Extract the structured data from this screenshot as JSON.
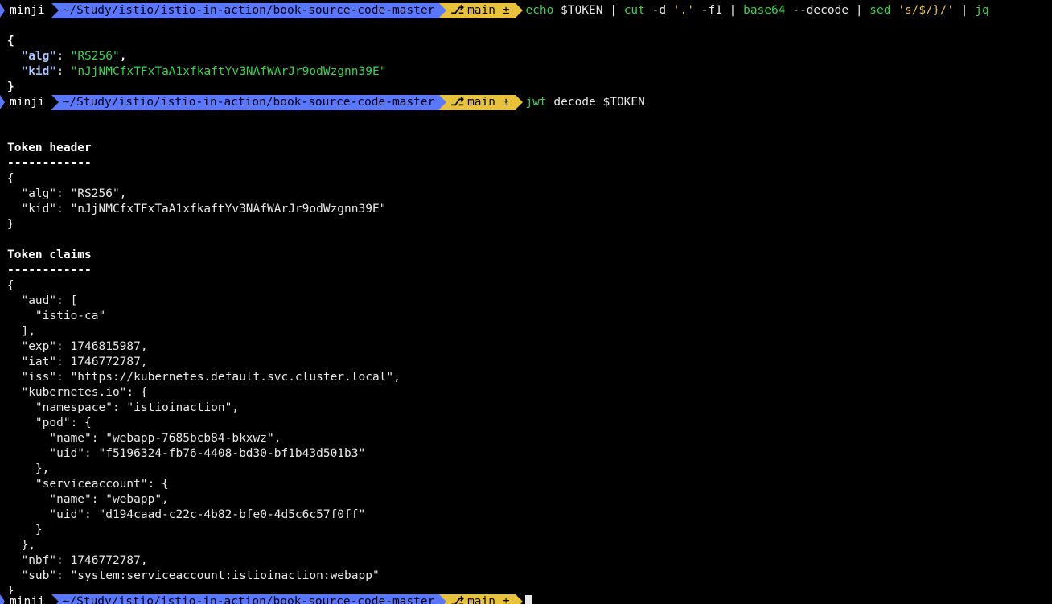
{
  "prompt": {
    "user": "minji",
    "path": "~/Study/istio/istio-in-action/book-source-code-master",
    "branch": "main ±",
    "branch_icon": "git-branch-icon"
  },
  "cmd1": {
    "echo": "echo",
    "p1": " $TOKEN | ",
    "cut": "cut",
    "p2": " -d ",
    "q1": "'.'",
    "p3": " -f1 | ",
    "base64": "base64",
    "p4": " --decode | ",
    "sed": "sed",
    "p5": " ",
    "q2": "'s/$/}/'",
    "p6": " | ",
    "jq": "jq"
  },
  "jq_output": {
    "open": "{",
    "alg_key": "\"alg\"",
    "alg_val": "\"RS256\"",
    "kid_key": "\"kid\"",
    "kid_val": "\"nJjNMCfxTFxTaA1xfkaftYv3NAfWArJr9odWzgnn39E\"",
    "close": "}"
  },
  "cmd2": {
    "jwt": "jwt",
    "rest": " decode $TOKEN"
  },
  "decode_output": {
    "header_title": "Token header",
    "header_rule": "------------",
    "header_lines": [
      "{",
      "  \"alg\": \"RS256\",",
      "  \"kid\": \"nJjNMCfxTFxTaA1xfkaftYv3NAfWArJr9odWzgnn39E\"",
      "}"
    ],
    "claims_title": "Token claims",
    "claims_rule": "------------",
    "claims_lines": [
      "{",
      "  \"aud\": [",
      "    \"istio-ca\"",
      "  ],",
      "  \"exp\": 1746815987,",
      "  \"iat\": 1746772787,",
      "  \"iss\": \"https://kubernetes.default.svc.cluster.local\",",
      "  \"kubernetes.io\": {",
      "    \"namespace\": \"istioinaction\",",
      "    \"pod\": {",
      "      \"name\": \"webapp-7685bcb84-bkxwz\",",
      "      \"uid\": \"f5196324-fb76-4408-bd30-bf1b43d501b3\"",
      "    },",
      "    \"serviceaccount\": {",
      "      \"name\": \"webapp\",",
      "      \"uid\": \"d194caad-c22c-4b82-bfe0-4d5c6c57f0ff\"",
      "    }",
      "  },",
      "  \"nbf\": 1746772787,",
      "  \"sub\": \"system:serviceaccount:istioinaction:webapp\"",
      "}"
    ]
  }
}
